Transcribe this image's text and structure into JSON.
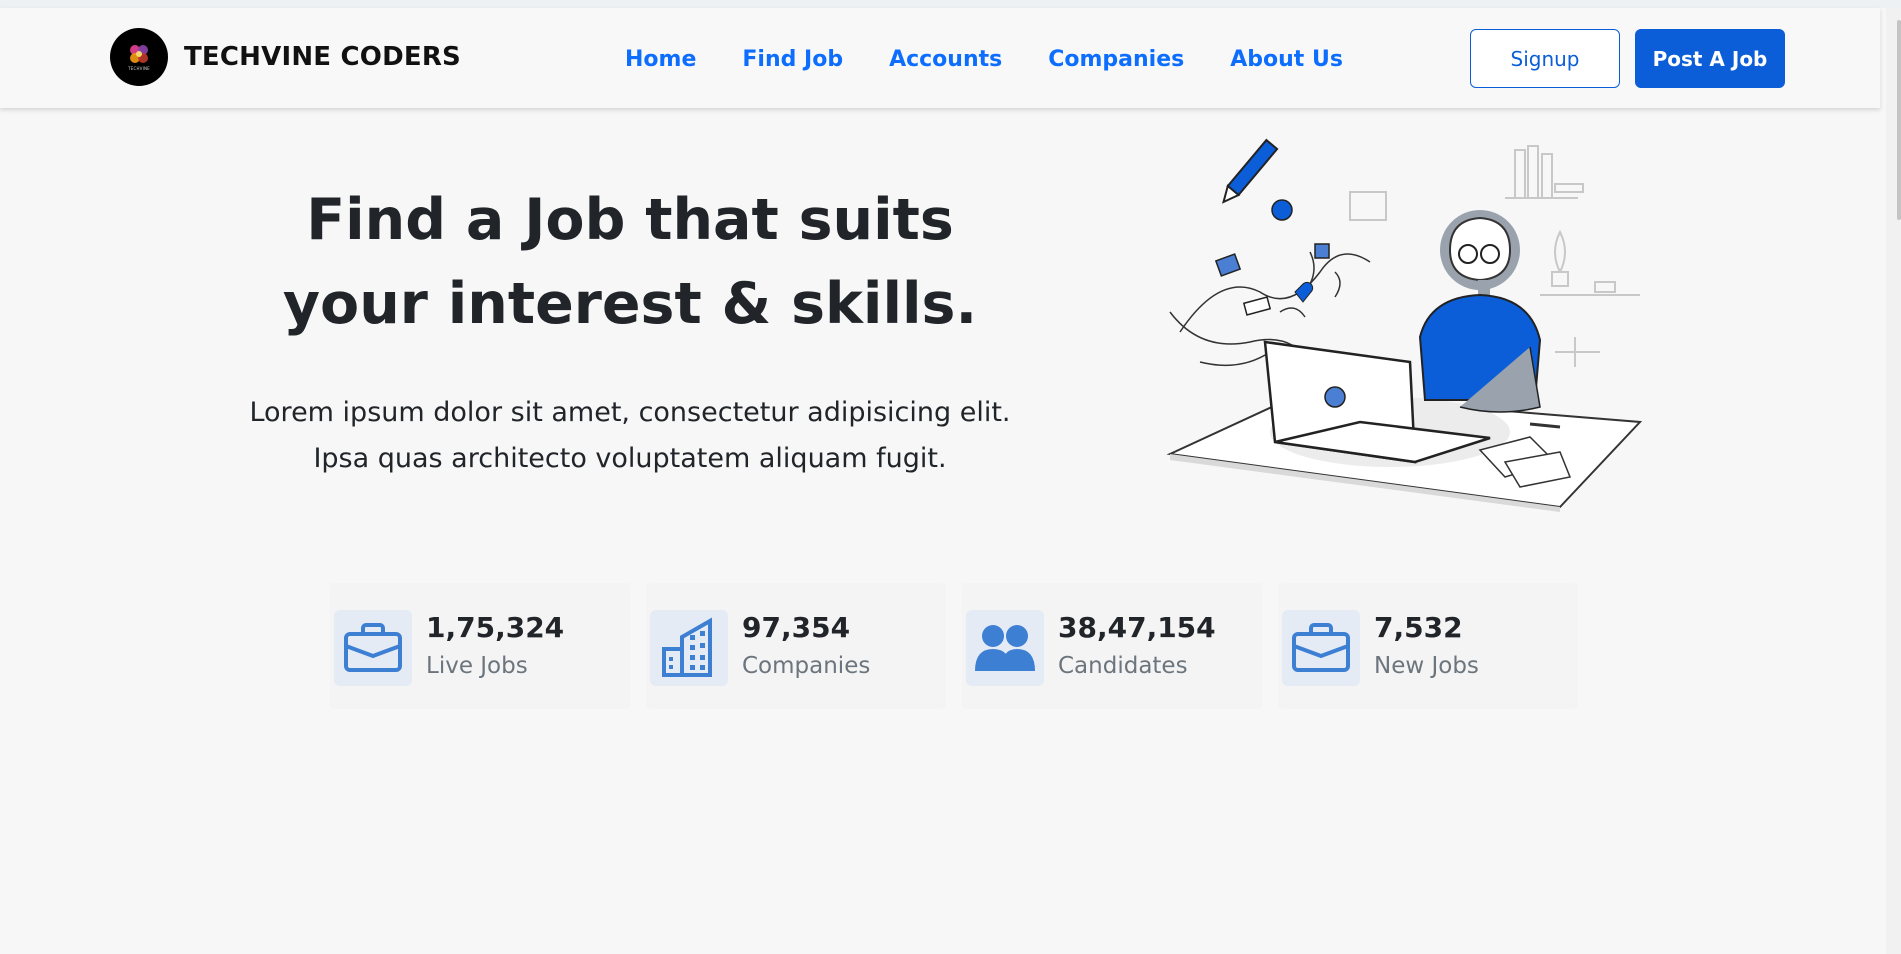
{
  "nav": {
    "brand": "TECHVINE CODERS",
    "logo_text": "TECHVINE",
    "links": [
      {
        "label": "Home"
      },
      {
        "label": "Find Job"
      },
      {
        "label": "Accounts"
      },
      {
        "label": "Companies"
      },
      {
        "label": "About Us"
      }
    ],
    "signup_label": "Signup",
    "post_job_label": "Post A Job"
  },
  "hero": {
    "title_line1": "Find a Job that suits",
    "title_line2": "your interest & skills.",
    "text_line1": "Lorem ipsum dolor sit amet, consectetur adipisicing elit.",
    "text_line2": "Ipsa quas architecto voluptatem aliquam fugit."
  },
  "stats": [
    {
      "value": "1,75,324",
      "label": "Live Jobs",
      "icon": "briefcase-icon"
    },
    {
      "value": "97,354",
      "label": "Companies",
      "icon": "building-icon"
    },
    {
      "value": "38,47,154",
      "label": "Candidates",
      "icon": "users-icon"
    },
    {
      "value": "7,532",
      "label": "New Jobs",
      "icon": "briefcase-icon"
    }
  ],
  "colors": {
    "accent": "#0b5ed7",
    "link": "#0d6efd",
    "icon_bg": "#e4ebf5",
    "background": "#f7f7f7"
  }
}
